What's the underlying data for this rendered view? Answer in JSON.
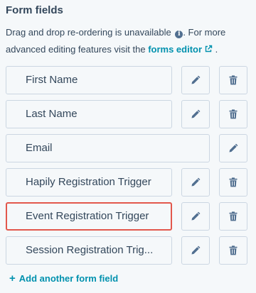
{
  "section": {
    "title": "Form fields",
    "description_pre": "Drag and drop re-ordering is unavailable",
    "description_mid": ". For more advanced editing features visit the ",
    "editor_link": "forms editor",
    "description_post": " ."
  },
  "fields": [
    {
      "label": "First Name",
      "deletable": true,
      "highlighted": false
    },
    {
      "label": "Last Name",
      "deletable": true,
      "highlighted": false
    },
    {
      "label": "Email",
      "deletable": false,
      "highlighted": false
    },
    {
      "label": "Hapily Registration Trigger",
      "deletable": true,
      "highlighted": false
    },
    {
      "label": "Event Registration Trigger",
      "deletable": true,
      "highlighted": true
    },
    {
      "label": "Session Registration Trig...",
      "deletable": true,
      "highlighted": false
    }
  ],
  "add_field": {
    "plus": "+",
    "label": "Add another form field"
  },
  "icons": {
    "info": "info-icon",
    "external": "external-link-icon",
    "edit": "pencil-icon",
    "delete": "trash-icon"
  },
  "colors": {
    "text": "#33475b",
    "link": "#0091ae",
    "border": "#cbd6e2",
    "highlight": "#e2574c",
    "background": "#f5f8fa"
  }
}
